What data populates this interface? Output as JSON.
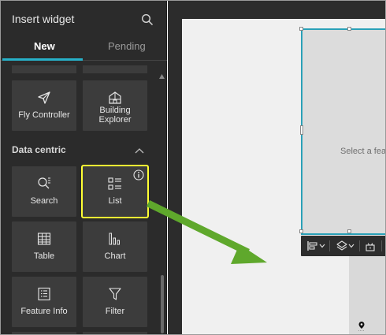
{
  "panel": {
    "title": "Insert widget",
    "tabs": [
      {
        "label": "New",
        "active": true
      },
      {
        "label": "Pending",
        "active": false
      }
    ]
  },
  "widgets_top": [
    {
      "label": "Fly Controller",
      "icon": "paper-plane-icon"
    },
    {
      "label": "Building Explorer",
      "icon": "building-icon"
    }
  ],
  "section": {
    "title": "Data centric",
    "collapsed": false
  },
  "widgets_data": [
    {
      "label": "Search",
      "icon": "search-icon"
    },
    {
      "label": "List",
      "icon": "list-icon",
      "highlighted": true
    },
    {
      "label": "Table",
      "icon": "table-icon"
    },
    {
      "label": "Chart",
      "icon": "bar-chart-icon"
    },
    {
      "label": "Feature Info",
      "icon": "feature-info-icon"
    },
    {
      "label": "Filter",
      "icon": "filter-icon"
    }
  ],
  "canvas": {
    "placeholder_text": "Select a feat"
  },
  "colors": {
    "panel_bg": "#2b2b2b",
    "tile_bg": "#3c3c3c",
    "accent": "#27b1c9",
    "highlight": "#ffff33",
    "arrow": "#5fa82c"
  }
}
